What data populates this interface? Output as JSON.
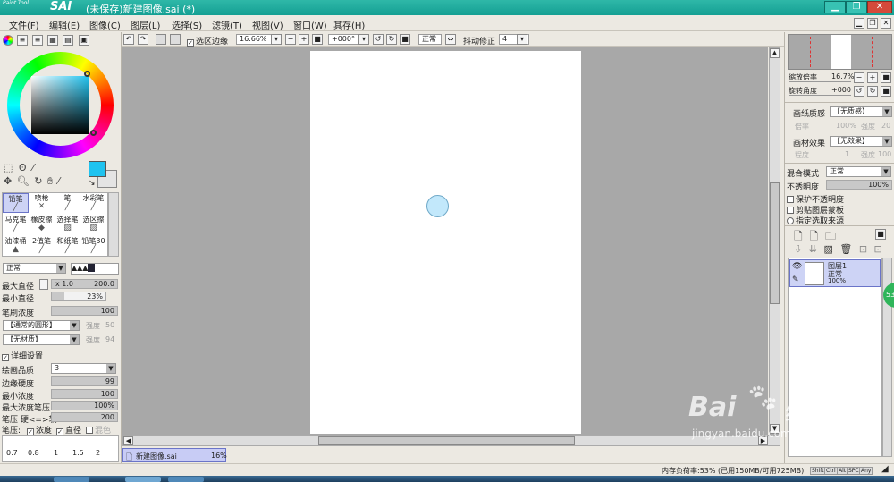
{
  "window": {
    "logo_small": "Paint Tool",
    "logo": "SAI",
    "title": "(未保存)新建图像.sai (*)"
  },
  "menu": [
    "文件(F)",
    "编辑(E)",
    "图像(C)",
    "图层(L)",
    "选择(S)",
    "滤镜(T)",
    "视图(V)",
    "窗口(W)",
    "其存(H)"
  ],
  "toolbar": {
    "select_edge_label": "选区边缘",
    "zoom": "16.66%",
    "rotation": "+000°",
    "blend": "正常",
    "stabilizer_label": "抖动修正",
    "stabilizer": "4"
  },
  "colors": {
    "primary": "#1fc3f0",
    "secondary": "#e4e4e4",
    "brush_stroke": "#c2e8fb"
  },
  "tools": [
    [
      "铅笔",
      "喷枪",
      "笔",
      "水彩笔"
    ],
    [
      "马克笔",
      "橡皮擦",
      "选择笔",
      "选区擦"
    ],
    [
      "油漆桶",
      "2值笔",
      "和纸笔",
      "铅笔30"
    ]
  ],
  "brush": {
    "mode": "正常",
    "max_diameter_label": "最大直径",
    "max_diameter_mult": "x 1.0",
    "max_diameter": "200.0",
    "min_diameter_label": "最小直径",
    "min_diameter": "23%",
    "density_label": "笔刷浓度",
    "density": "100",
    "shape": "【通常的圆形】",
    "shape_strength_label": "强度",
    "shape_strength": "50",
    "texture": "【无材质】",
    "texture_strength_label": "强度",
    "texture_strength": "94",
    "detail_label": "详细设置",
    "quality_label": "绘画品质",
    "quality": "3",
    "edge_label": "边缘硬度",
    "edge": "99",
    "min_density_label": "最小浓度",
    "min_density": "100",
    "max_pressure_label": "最大浓度笔压",
    "max_pressure": "100%",
    "pressure_hard_label": "笔压 硬<=>软",
    "pressure_hard": "200",
    "pressure_label": "笔压:",
    "density_chk": "浓度",
    "diameter_chk": "直径",
    "blend_chk": "混色",
    "sizes": [
      "0.7",
      "0.8",
      "1",
      "1.5",
      "2"
    ]
  },
  "navigator": {
    "zoom_label": "缩放倍率",
    "zoom": "16.7%",
    "rotate_label": "旋转角度",
    "rotate": "+000"
  },
  "paper": {
    "texture_label": "画纸质感",
    "texture": "【无质感】",
    "tex_scale_label": "倍率",
    "tex_scale": "100%",
    "tex_strength_label": "强度",
    "tex_strength": "20",
    "effect_label": "画材效果",
    "effect": "【无效果】",
    "eff_level_label": "程度",
    "eff_level": "1",
    "eff_strength_label": "强度",
    "eff_strength": "100"
  },
  "layer_opts": {
    "blend_label": "混合模式",
    "blend": "正常",
    "opacity_label": "不透明度",
    "opacity": "100%",
    "protect": "保护不透明度",
    "clip": "剪贴图层蒙板",
    "source": "指定选取来源"
  },
  "layer": {
    "name": "图层1",
    "mode": "正常",
    "opacity": "100%"
  },
  "tab": {
    "name": "新建图像.sai",
    "zoom": "16%"
  },
  "status": {
    "memory": "内存负荷率:53% (已用150MB/可用725MB)",
    "keys": [
      "Shift",
      "Ctrl",
      "Alt",
      "SPC",
      "Any"
    ]
  },
  "badge": "53",
  "watermark": {
    "brand": "Bai",
    "brand2": "经验",
    "url": "jingyan.baidu.com"
  }
}
